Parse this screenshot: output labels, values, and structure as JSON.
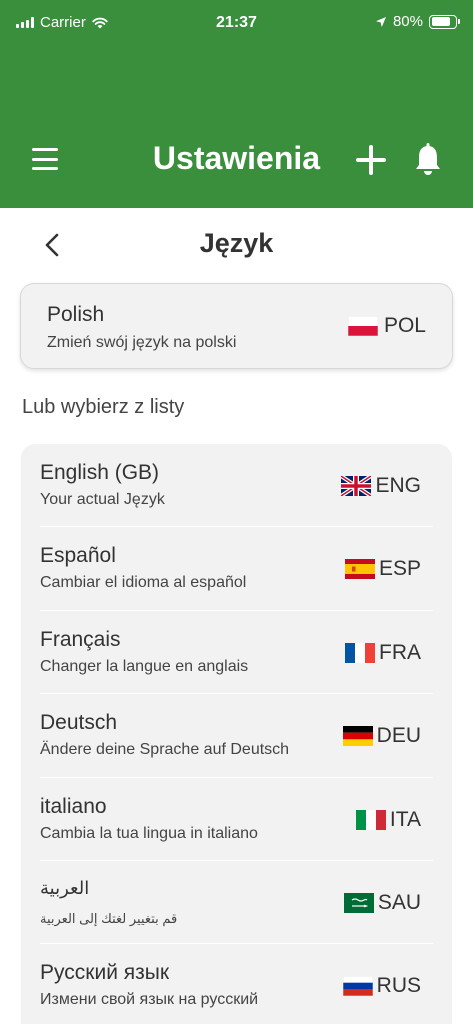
{
  "status_bar": {
    "carrier": "Carrier",
    "time": "21:37",
    "battery": "80%"
  },
  "header": {
    "title": "Ustawienia"
  },
  "sub_header": {
    "title": "Język"
  },
  "current_language": {
    "name": "Polish",
    "description": "Zmień swój język na polski",
    "code": "POL",
    "flag_icon": "poland-flag-icon"
  },
  "section_label": "Lub wybierz z listy",
  "languages": [
    {
      "name": "English (GB)",
      "description": "Your actual Język",
      "code": "ENG",
      "flag_icon": "uk-flag-icon"
    },
    {
      "name": "Español",
      "description": "Cambiar el idioma al español",
      "code": "ESP",
      "flag_icon": "spain-flag-icon"
    },
    {
      "name": "Français",
      "description": "Changer la langue en anglais",
      "code": "FRA",
      "flag_icon": "france-flag-icon"
    },
    {
      "name": "Deutsch",
      "description": "Ändere deine Sprache auf Deutsch",
      "code": "DEU",
      "flag_icon": "germany-flag-icon"
    },
    {
      "name": "italiano",
      "description": "Cambia la tua lingua in italiano",
      "code": "ITA",
      "flag_icon": "italy-flag-icon"
    },
    {
      "name": "العربية",
      "description": "قم بتغيير لغتك إلى العربية",
      "code": "SAU",
      "flag_icon": "saudi-arabia-flag-icon"
    },
    {
      "name": "Русский язык",
      "description": "Измени свой язык на русский",
      "code": "RUS",
      "flag_icon": "russia-flag-icon"
    }
  ],
  "colors": {
    "header_bg": "#3a8f3c",
    "card_bg": "#f2f2f2",
    "text": "#333333"
  }
}
